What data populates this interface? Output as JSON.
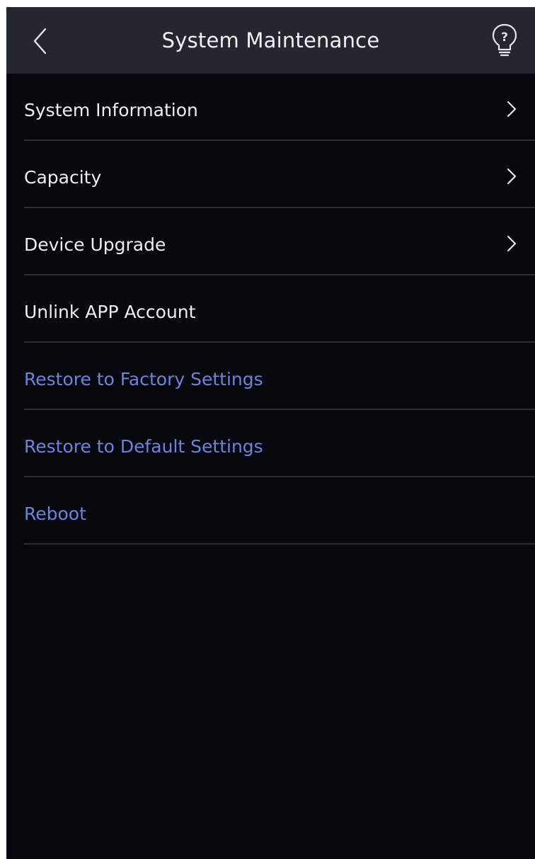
{
  "header": {
    "title": "System Maintenance",
    "back_icon": "chevron-left-icon",
    "help_icon": "question-bulb-icon"
  },
  "menu": {
    "items": [
      {
        "label": "System Information",
        "has_chevron": true,
        "style": "normal"
      },
      {
        "label": "Capacity",
        "has_chevron": true,
        "style": "normal"
      },
      {
        "label": "Device Upgrade",
        "has_chevron": true,
        "style": "normal"
      },
      {
        "label": "Unlink APP Account",
        "has_chevron": false,
        "style": "normal"
      },
      {
        "label": "Restore to Factory Settings",
        "has_chevron": false,
        "style": "accent"
      },
      {
        "label": "Restore to Default Settings",
        "has_chevron": false,
        "style": "accent"
      },
      {
        "label": "Reboot",
        "has_chevron": false,
        "style": "accent"
      }
    ]
  },
  "colors": {
    "background": "#07080e",
    "header": "#242630",
    "text": "#eeeef0",
    "accent": "#6a85dd",
    "divider": "#2c2d35"
  }
}
